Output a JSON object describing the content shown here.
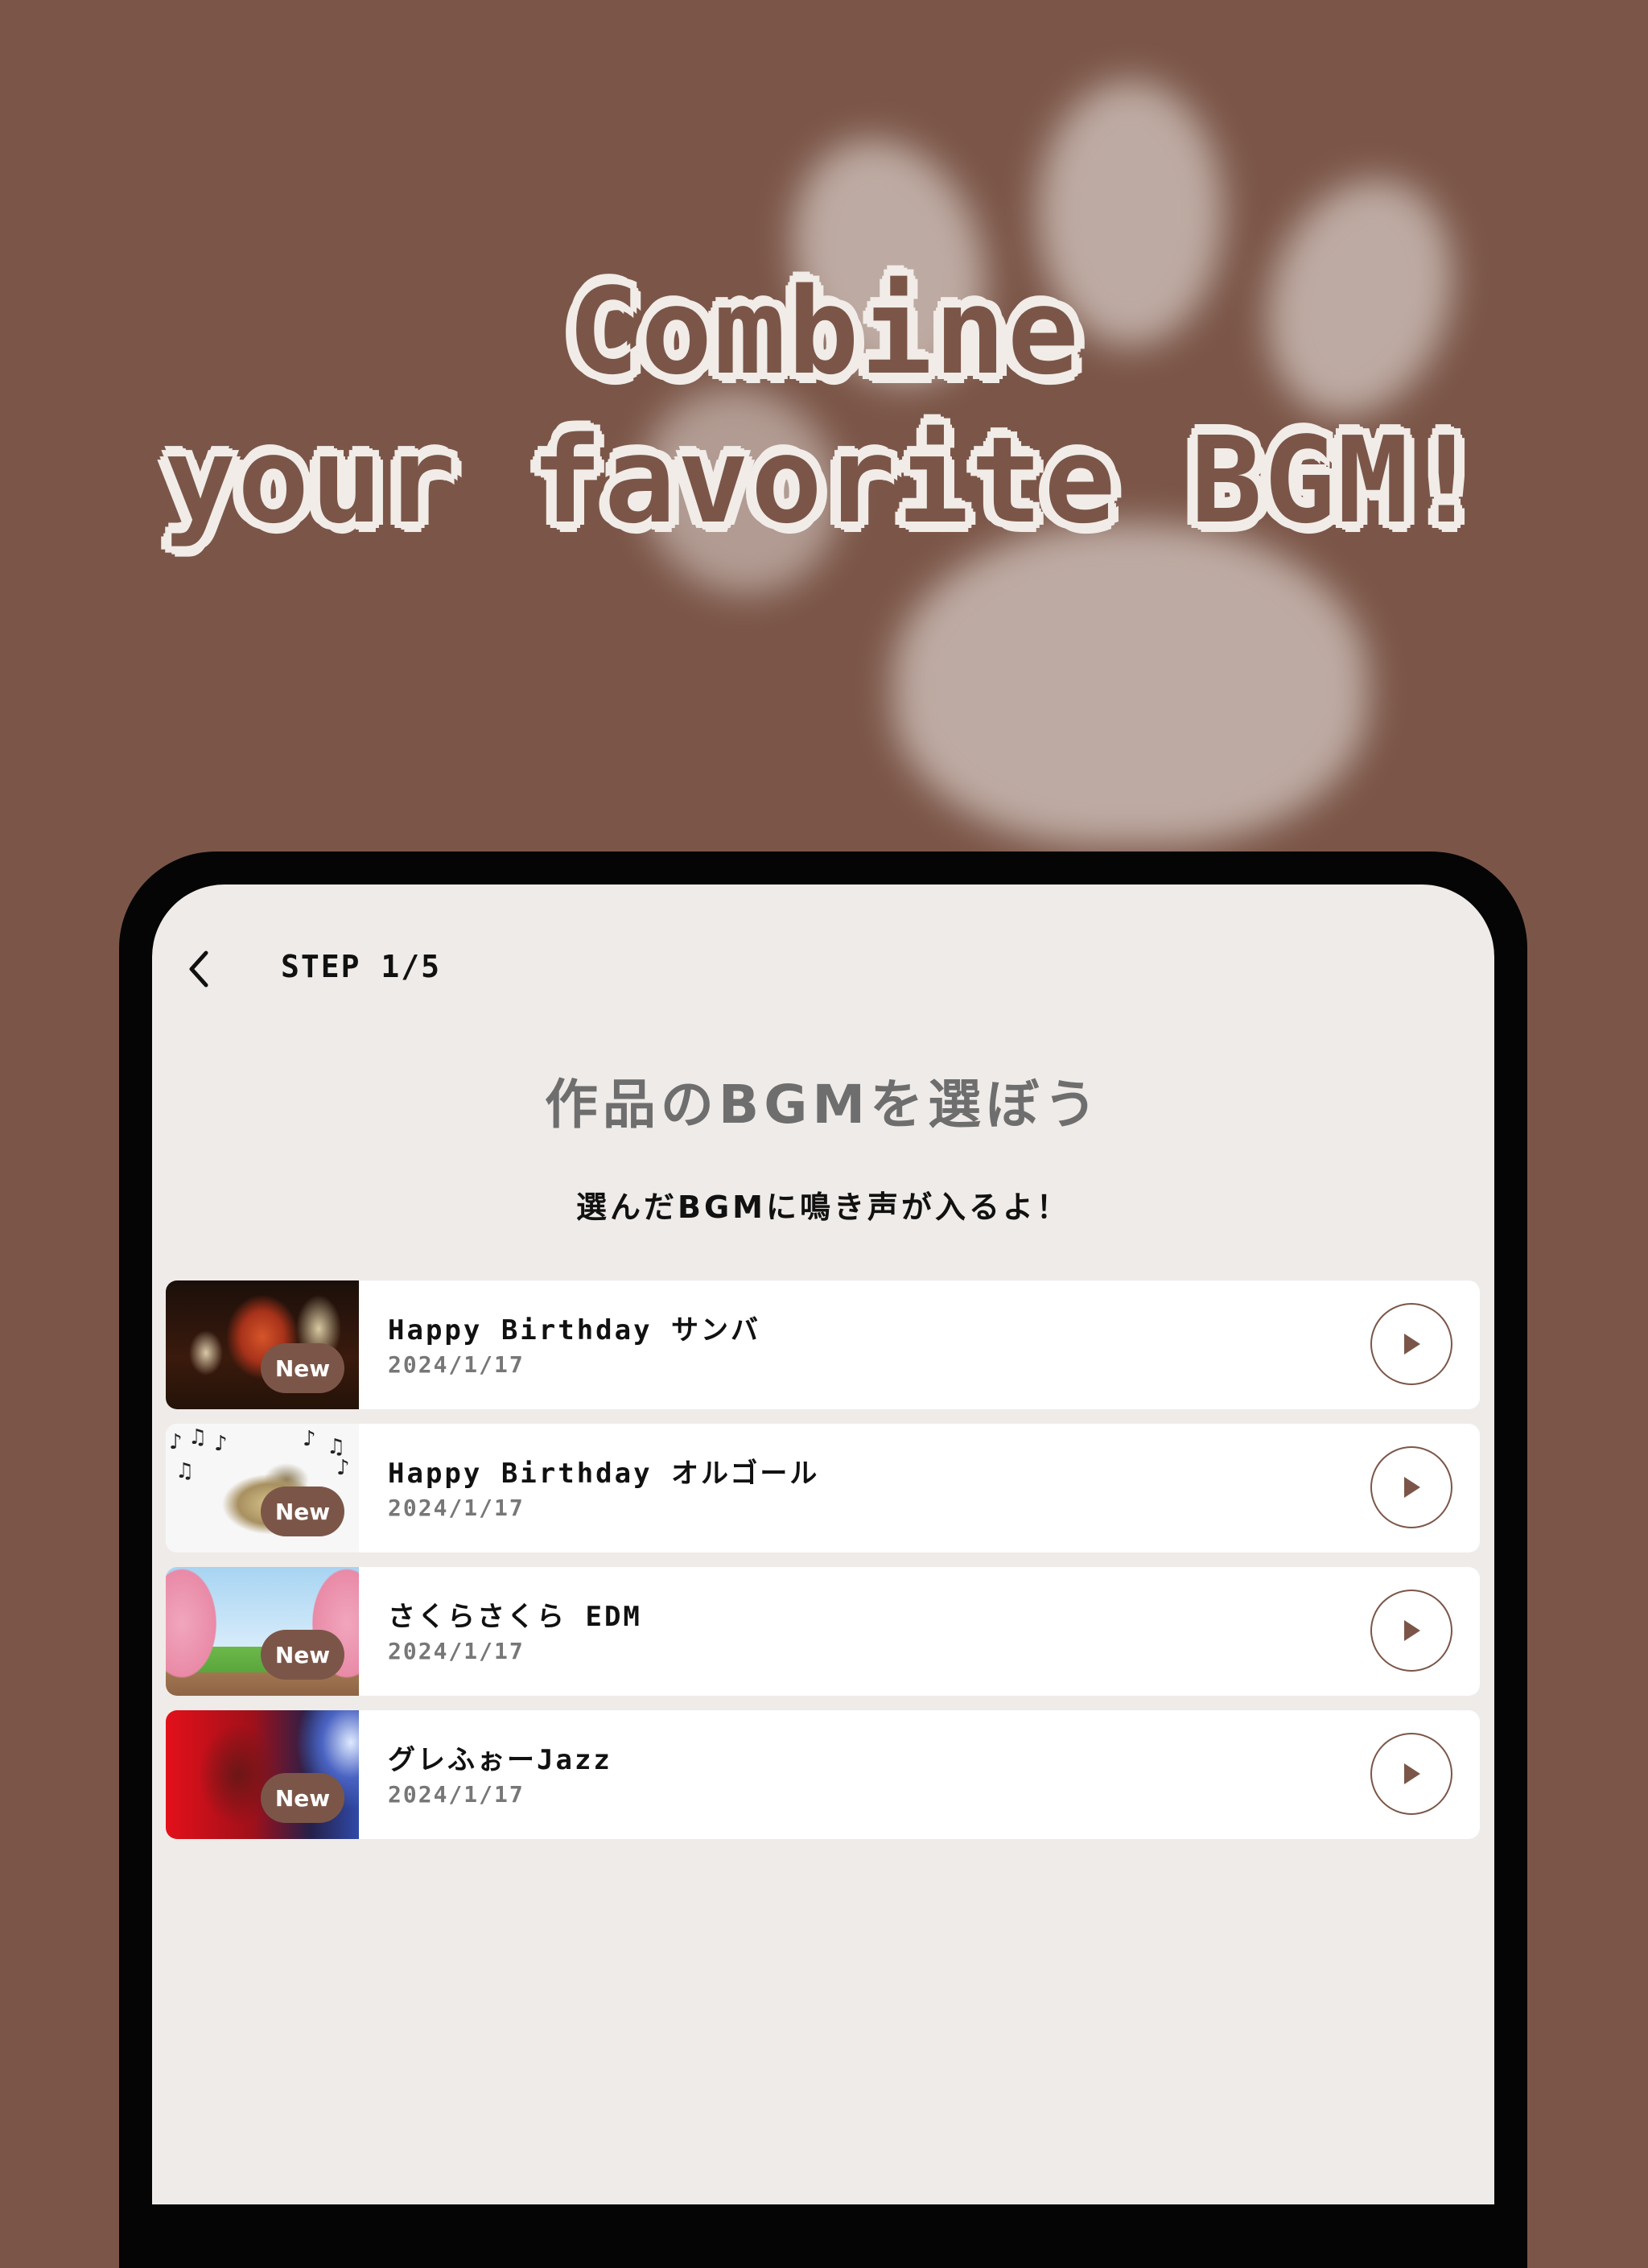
{
  "headline": {
    "line1": "Combine",
    "line2": "your favorite BGM!"
  },
  "header": {
    "step_label": "STEP 1/5",
    "back_icon": "chevron-left-icon"
  },
  "page": {
    "title": "作品のBGMを選ぼう",
    "subtitle": "選んだBGMに鳴き声が入るよ！"
  },
  "tracks": [
    {
      "title": "Happy Birthday サンバ",
      "date": "2024/1/17",
      "badge": "New",
      "thumbnail": "samba-dancers"
    },
    {
      "title": "Happy Birthday オルゴール",
      "date": "2024/1/17",
      "badge": "New",
      "thumbnail": "music-box"
    },
    {
      "title": "さくらさくら EDM",
      "date": "2024/1/17",
      "badge": "New",
      "thumbnail": "cherry-blossom-road"
    },
    {
      "title": "グレふぉーJazz",
      "date": "2024/1/17",
      "badge": "New",
      "thumbnail": "saxophone-player"
    }
  ],
  "colors": {
    "brand_brown": "#7b5648",
    "screen_bg": "#efebe8",
    "headline_outline": "#f1ece8",
    "title_gray": "#6e6e6e"
  }
}
